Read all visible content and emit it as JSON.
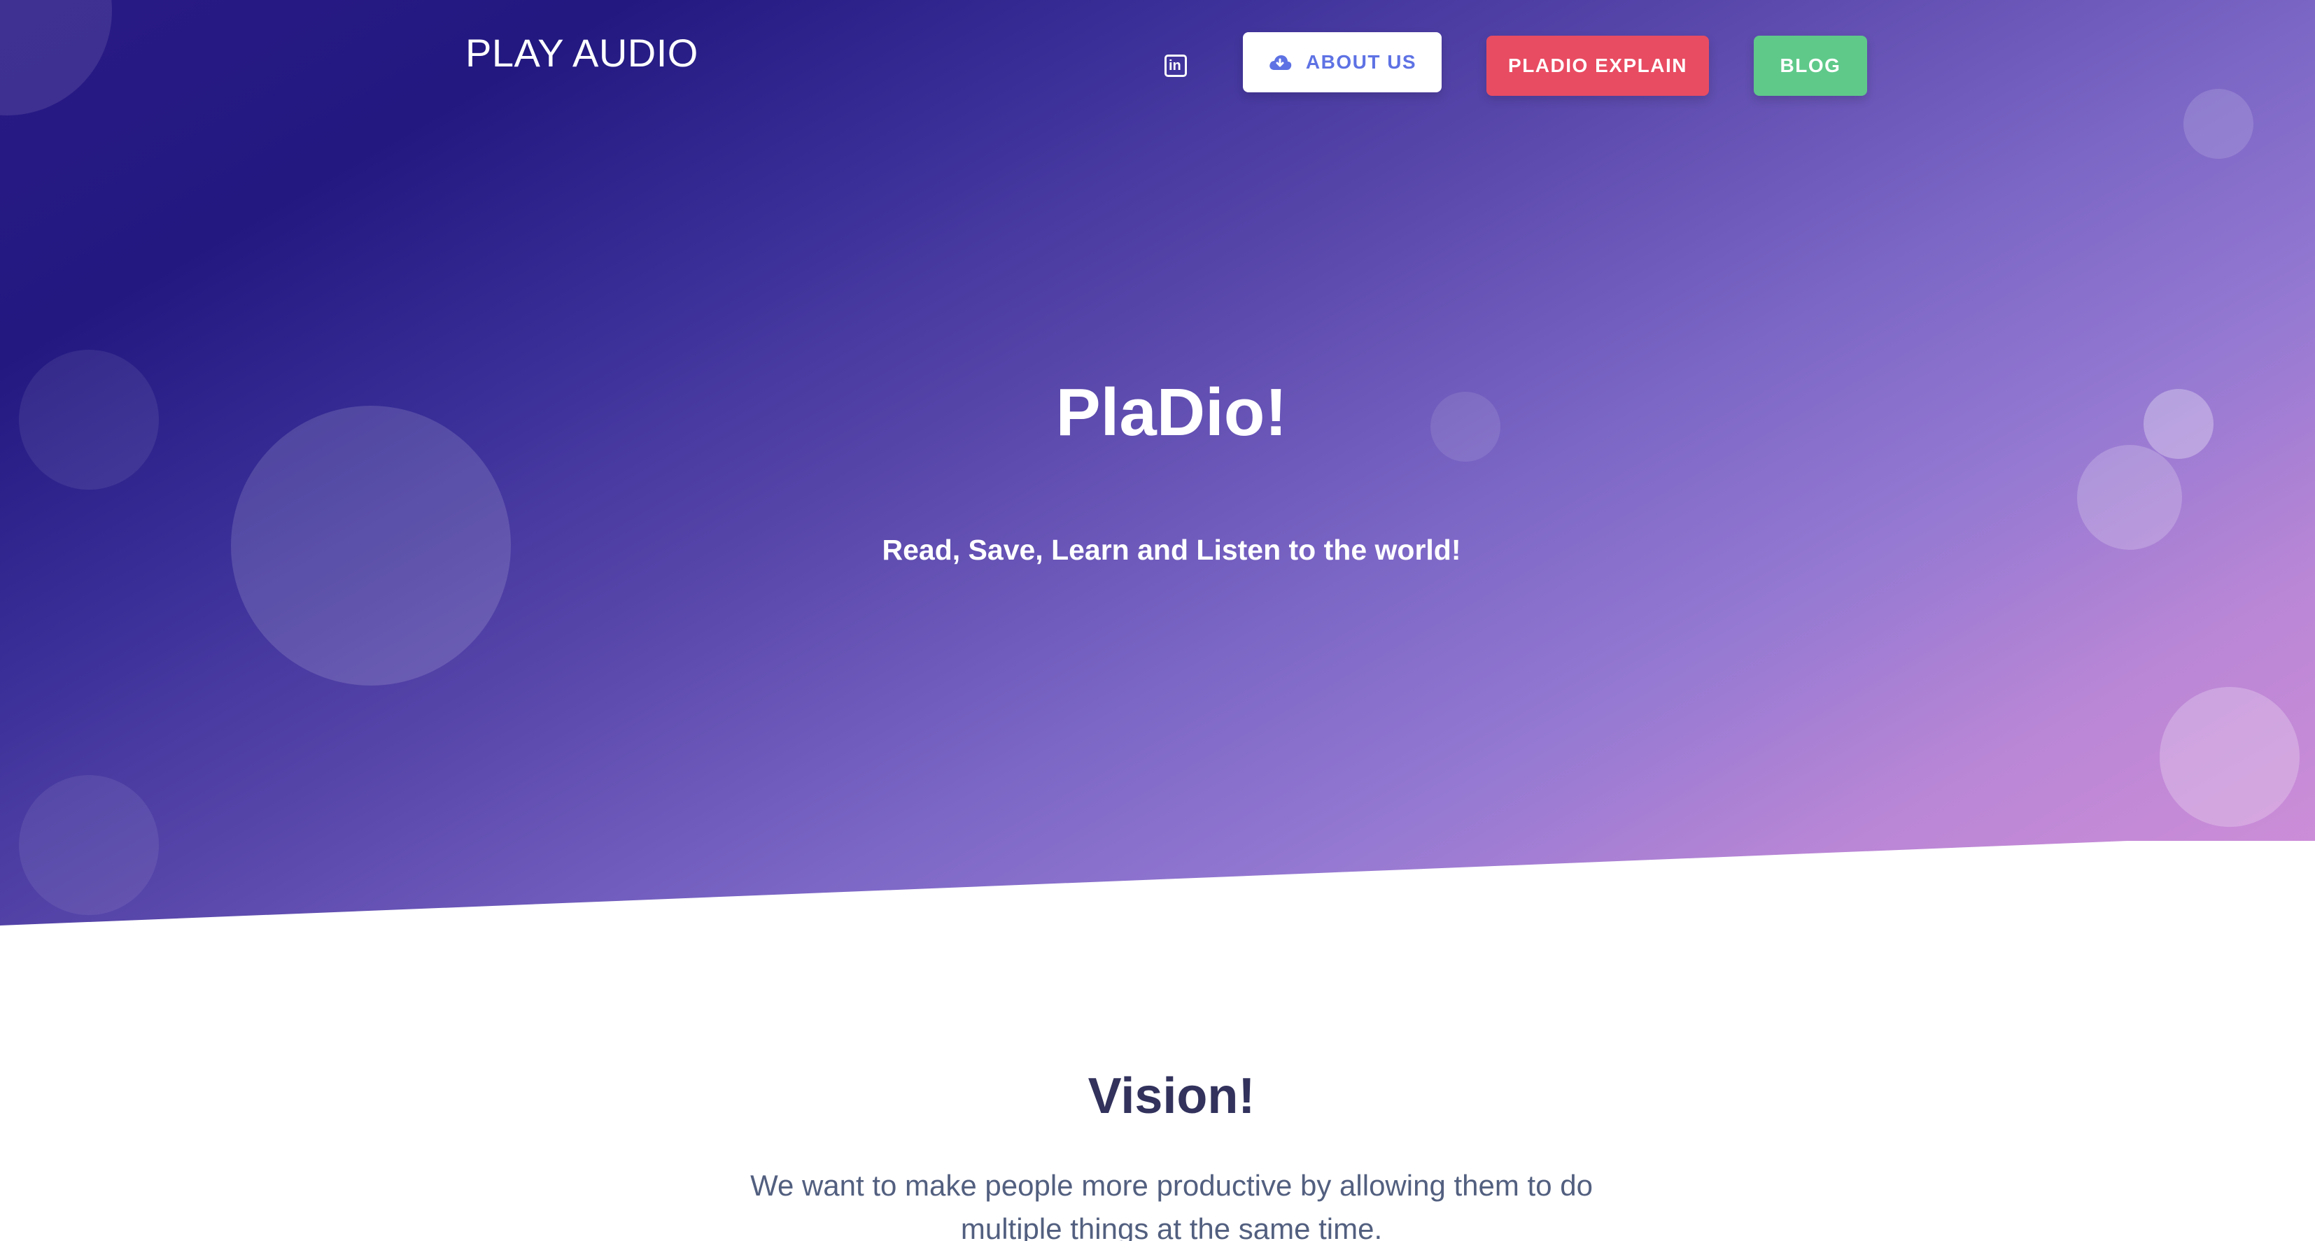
{
  "navbar": {
    "brand": "PLAY AUDIO",
    "linkedin_icon": "linkedin-icon",
    "about_label": "ABOUT US",
    "about_icon": "cloud-download-icon",
    "explain_label": "PLADIO EXPLAIN",
    "blog_label": "BLOG"
  },
  "hero": {
    "title": "PlaDio!",
    "subtitle": "Read, Save, Learn and Listen to the world!"
  },
  "vision": {
    "title": "Vision!",
    "text": "We want to make people more productive by allowing them to do multiple things at the same time."
  },
  "colors": {
    "about_text": "#5e72e4",
    "explain_bg": "#e84c62",
    "blog_bg": "#5fc98a",
    "heading_dark": "#32325d",
    "body_text": "#525f7f"
  }
}
